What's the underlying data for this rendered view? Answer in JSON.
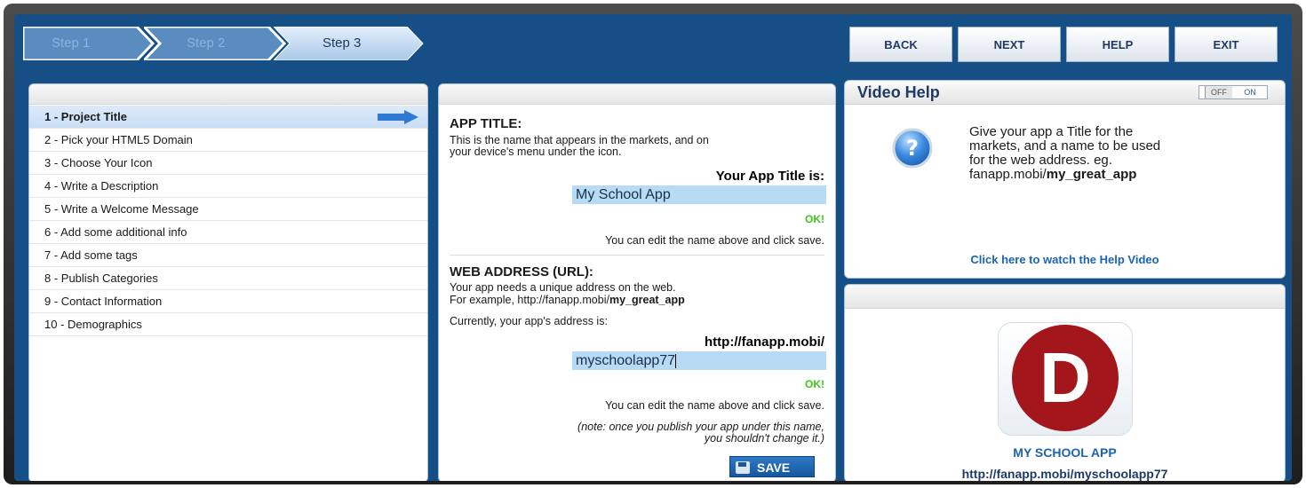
{
  "steps": [
    {
      "label": "Step 1",
      "state": "done"
    },
    {
      "label": "Step 2",
      "state": "done"
    },
    {
      "label": "Step 3",
      "state": "active"
    }
  ],
  "nav": {
    "back": "BACK",
    "next": "NEXT",
    "help": "HELP",
    "exit": "EXIT"
  },
  "sidebar": {
    "items": [
      {
        "label": "1 - Project Title"
      },
      {
        "label": "2 - Pick your HTML5 Domain"
      },
      {
        "label": "3 - Choose Your Icon"
      },
      {
        "label": "4 - Write a Description"
      },
      {
        "label": "5 - Write a Welcome Message"
      },
      {
        "label": "6 - Add some additional info"
      },
      {
        "label": "7 - Add some tags"
      },
      {
        "label": "8 - Publish Categories"
      },
      {
        "label": "9 - Contact Information"
      },
      {
        "label": "10 - Demographics"
      }
    ]
  },
  "app_title": {
    "heading": "APP TITLE:",
    "desc1": "This is the name that appears in the markets, and on",
    "desc2": "your device's menu under the icon.",
    "label": "Your App Title is:",
    "value": "My School App",
    "ok": "OK!",
    "hint": "You can edit the name above and click save."
  },
  "web_address": {
    "heading": "WEB ADDRESS (URL):",
    "desc1": "Your app needs a unique address on the web.",
    "desc2_prefix": "For example, http://fanapp.mobi/",
    "desc2_bold": "my_great_app",
    "current": "Currently, your app's address is:",
    "base_url": "http://fanapp.mobi/",
    "value": "myschoolapp77",
    "ok": "OK!",
    "hint": "You can edit the name above and click save.",
    "note1": "(note: once you publish your app under this name,",
    "note2": "you shouldn't change it.)"
  },
  "save_label": "SAVE",
  "video_help": {
    "title": "Video Help",
    "toggle_off": "OFF",
    "toggle_on": "ON",
    "line1": "Give your app a Title for the",
    "line2": "markets, and a name to be used",
    "line3": "for the web address. eg.",
    "line4_prefix": "fanapp.mobi/",
    "line4_bold": "my_great_app",
    "link": "Click here to watch the Help Video"
  },
  "preview": {
    "icon_letter": "D",
    "app_name": "MY SCHOOL APP",
    "url": "http://fanapp.mobi/myschoolapp77"
  },
  "colors": {
    "background": "#164e86",
    "accent": "#1b64b0",
    "ok": "#3fc51a",
    "field": "#b8dbf5",
    "icon_red": "#a2161c"
  }
}
